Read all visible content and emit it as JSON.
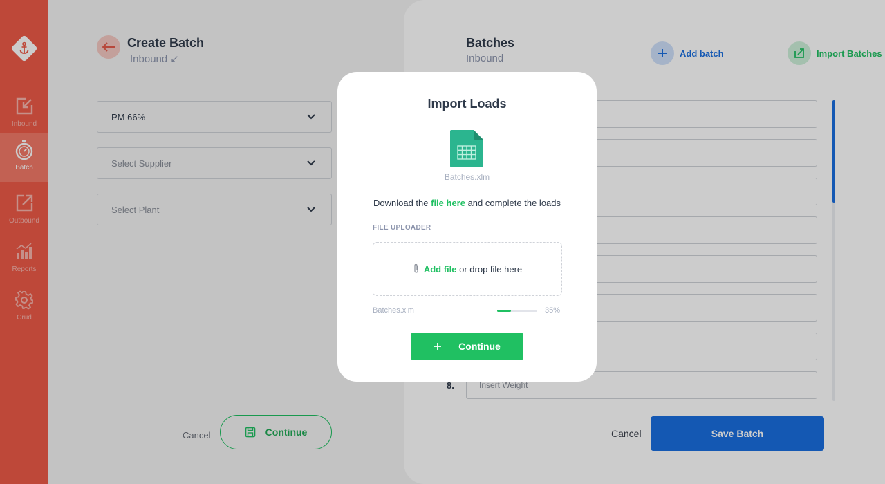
{
  "sidebar": {
    "items": [
      {
        "label": "Inbound",
        "icon": "inbound-icon"
      },
      {
        "label": "Batch",
        "icon": "batch-icon",
        "active": true
      },
      {
        "label": "Outbound",
        "icon": "outbound-icon"
      },
      {
        "label": "Reports",
        "icon": "reports-icon"
      },
      {
        "label": "Crud",
        "icon": "crud-icon"
      }
    ]
  },
  "create": {
    "title": "Create Batch",
    "subtitle": "Inbound ↙",
    "selects": [
      {
        "value": "PM 66%",
        "placeholder": ""
      },
      {
        "value": "",
        "placeholder": "Select Supplier"
      },
      {
        "value": "",
        "placeholder": "Select Plant"
      }
    ],
    "cancel_label": "Cancel",
    "continue_label": "Continue"
  },
  "batches": {
    "title": "Batches",
    "subtitle": "Inbound",
    "add_label": "Add batch",
    "import_label": "Import Batches",
    "last_row_number": "8.",
    "last_row_placeholder": "Insert Weight",
    "cancel_label": "Cancel",
    "save_label": "Save Batch"
  },
  "modal": {
    "title": "Import Loads",
    "file_name": "Batches.xlm",
    "download_prefix": "Download the ",
    "download_link": "file here",
    "download_suffix": " and complete the loads",
    "uploader_label": "FILE UPLOADER",
    "add_file_link": "Add file",
    "drop_text": " or drop file here",
    "progress_file": "Batches.xlm",
    "progress_percent": 35,
    "progress_label": "35%",
    "continue_label": "Continue"
  },
  "colors": {
    "sidebar": "#ee5a48",
    "primary_blue": "#1a6fe0",
    "green": "#20c062"
  }
}
